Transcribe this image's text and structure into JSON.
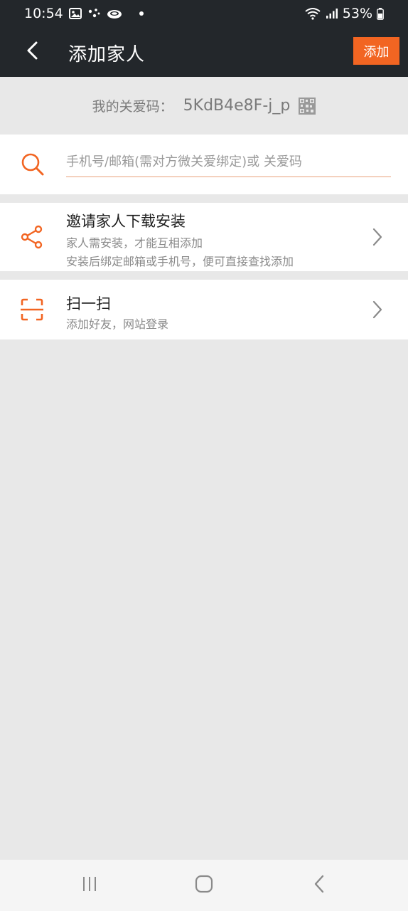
{
  "status_bar": {
    "time": "10:54",
    "battery": "53%",
    "icons": [
      "gallery-icon",
      "dots-icon",
      "cloud-icon",
      "notification-dot-icon",
      "wifi-icon",
      "signal-icon",
      "battery-icon"
    ]
  },
  "app_bar": {
    "title": "添加家人",
    "add_label": "添加",
    "back_icon": "back-arrow-icon"
  },
  "care_code": {
    "label": "我的关爱码：",
    "value": "5KdB4e8F-j_p",
    "icon": "qr-code-icon"
  },
  "search": {
    "placeholder": "手机号/邮箱(需对方微关爱绑定)或 关爱码",
    "value": "",
    "icon": "search-icon"
  },
  "rows": [
    {
      "icon": "share-icon",
      "title": "邀请家人下载安装",
      "lines": [
        "家人需安装，才能互相添加",
        "安装后绑定邮箱或手机号，便可直接查找添加"
      ]
    },
    {
      "icon": "scan-icon",
      "title": "扫一扫",
      "lines": [
        "添加好友，网站登录"
      ]
    }
  ],
  "colors": {
    "accent": "#f26522",
    "header_bg": "#23272b",
    "page_bg": "#e8e8e8"
  },
  "nav_bar": {
    "icons": [
      "recent-apps-icon",
      "home-icon",
      "back-icon"
    ]
  }
}
